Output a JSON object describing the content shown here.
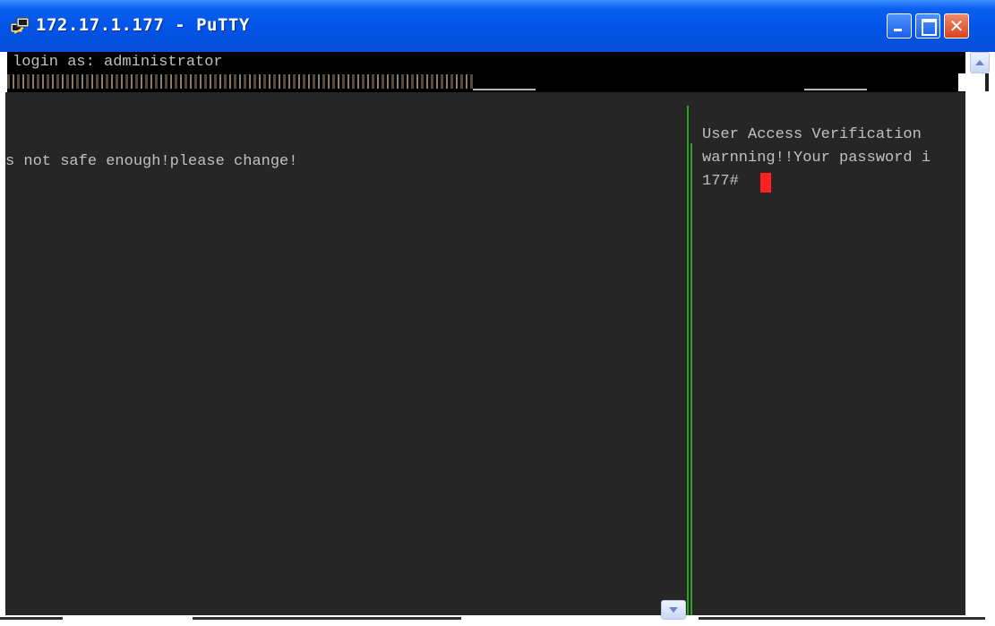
{
  "window": {
    "title": "172.17.1.177 - PuTTY",
    "app_icon": "putty-icon",
    "controls": {
      "minimize": "minimize-icon",
      "maximize": "maximize-icon",
      "close_glyph": "✕"
    }
  },
  "terminal": {
    "top_line": "login as: administrator",
    "left_line": "s not safe enough!please change!",
    "right_lines": [
      "User Access Verification",
      "warnning!!Your password i",
      "177#"
    ],
    "colors": {
      "background": "#262626",
      "text": "#c0c0c0",
      "cursor": "#ff2020",
      "artifact_line": "#2aa51a"
    }
  }
}
